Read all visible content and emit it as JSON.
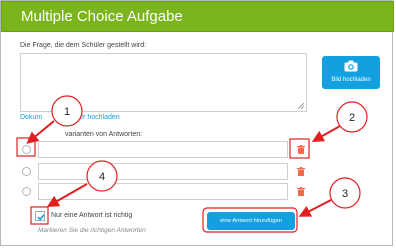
{
  "header": {
    "title": "Multiple Choice Aufgabe"
  },
  "question": {
    "label": "Die Frage, die dem Schüler gestellt wird:",
    "value": ""
  },
  "image_button": {
    "icon": "camera-icon",
    "label": "Bild hochladen"
  },
  "upload_link": {
    "visible_start": "Dokum",
    "visible_end": "er hochladen"
  },
  "answers": {
    "label": "varianten von Antworten:",
    "rows": [
      {
        "value": "",
        "selected": false
      },
      {
        "value": "",
        "selected": false
      },
      {
        "value": "",
        "selected": false
      }
    ]
  },
  "options": {
    "single_answer_label": "Nur eine Antwort ist richtig",
    "single_answer_checked": true,
    "hint": "Markieren Sie die richtigen Antworten"
  },
  "add_button": {
    "label": "eine Antwort hinzufügen"
  },
  "annotations": {
    "labels": [
      "1",
      "2",
      "3",
      "4"
    ],
    "color": "#e02020"
  },
  "colors": {
    "header": "#7ab51d",
    "accent": "#12a0e0",
    "trash": "#f26a4a"
  }
}
